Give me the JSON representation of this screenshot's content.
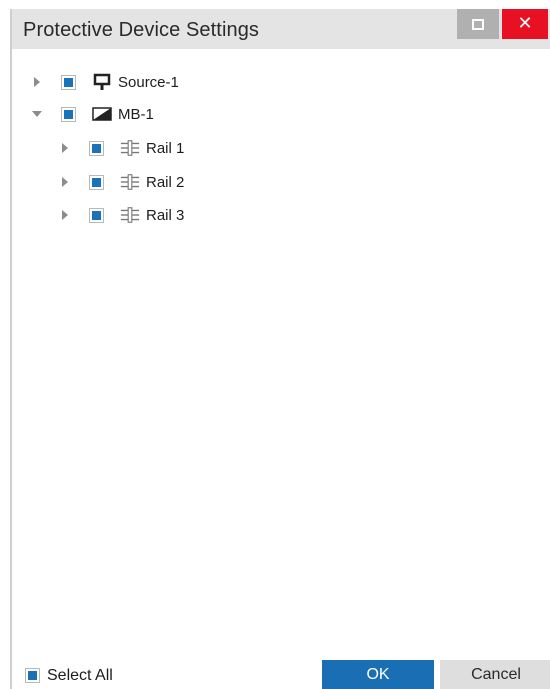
{
  "window": {
    "title": "Protective Device Settings",
    "maximize_icon": "maximize-icon",
    "close_icon": "close-icon",
    "close_glyph": "✕"
  },
  "tree": {
    "nodes": [
      {
        "label": "Source-1",
        "expanded": false,
        "checked": true,
        "icon": "source-icon"
      },
      {
        "label": "MB-1",
        "expanded": true,
        "checked": true,
        "icon": "main-board-icon"
      },
      {
        "label": "Rail 1",
        "expanded": false,
        "checked": true,
        "icon": "rail-icon"
      },
      {
        "label": "Rail 2",
        "expanded": false,
        "checked": true,
        "icon": "rail-icon"
      },
      {
        "label": "Rail 3",
        "expanded": false,
        "checked": true,
        "icon": "rail-icon"
      }
    ]
  },
  "footer": {
    "select_all_label": "Select All",
    "select_all_checked": true,
    "ok_label": "OK",
    "cancel_label": "Cancel"
  },
  "colors": {
    "accent": "#1a6fb4",
    "close_red": "#e81123",
    "titlebar": "#e4e4e4"
  }
}
